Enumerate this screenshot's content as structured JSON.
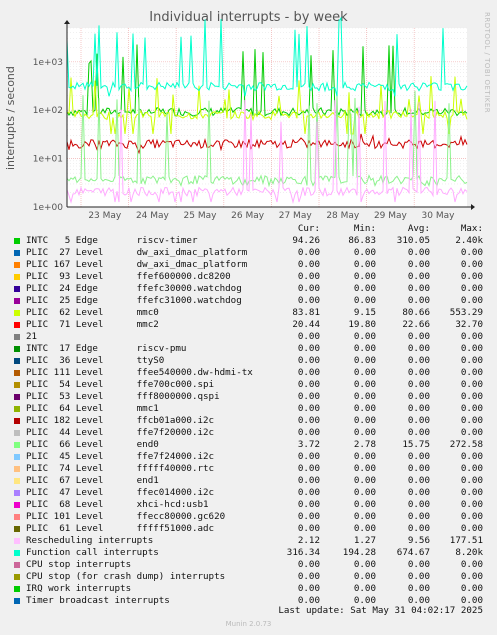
{
  "title": "Individual interrupts - by week",
  "side_text": "RRDTOOL / TOBI OETIKER",
  "ylabel": "interrupts / second",
  "headers": {
    "cur": "Cur:",
    "min": "Min:",
    "avg": "Avg:",
    "max": "Max:"
  },
  "footer": "Last update: Sat May 31 04:02:17 2025",
  "munin": "Munin 2.0.73",
  "chart_data": {
    "type": "line",
    "title": "Individual interrupts - by week",
    "ylabel": "interrupts / second",
    "yscale": "log",
    "ylim": [
      1,
      5000
    ],
    "yticks": [
      "1e+00",
      "1e+01",
      "1e+02",
      "1e+03"
    ],
    "xticks": [
      "23 May",
      "24 May",
      "25 May",
      "26 May",
      "27 May",
      "28 May",
      "29 May",
      "30 May"
    ],
    "grid": true,
    "series": [
      {
        "name": "INTC 5 Edge riscv-timer",
        "color": "#00cc00",
        "level": 94.26,
        "min": 86.83,
        "max": 2400
      },
      {
        "name": "PLIC 62 Level mmc0",
        "color": "#ccff00",
        "level": 80.66,
        "min": 9.15,
        "max": 553.29
      },
      {
        "name": "PLIC 71 Level mmc2",
        "color": "#cc0000",
        "level": 20.44,
        "min": 19.8,
        "max": 32.7
      },
      {
        "name": "PLIC 66 Level end0",
        "color": "#8cf28c",
        "level": 3.72,
        "min": 2.78,
        "max": 272.58
      },
      {
        "name": "Rescheduling interrupts",
        "color": "#ffaaff",
        "level": 2.12,
        "min": 1.27,
        "max": 177.51
      },
      {
        "name": "Function call interrupts",
        "color": "#00ffcc",
        "level": 316.34,
        "min": 194.28,
        "max": 8200
      }
    ]
  },
  "legend": [
    {
      "color": "#00cc00",
      "src": "INTC",
      "irq": "5",
      "type": "Edge",
      "name": "riscv-timer",
      "cur": "94.26",
      "min": "86.83",
      "avg": "310.05",
      "max": "2.40k"
    },
    {
      "color": "#0066b3",
      "src": "PLIC",
      "irq": "27",
      "type": "Level",
      "name": "dw_axi_dmac_platform",
      "cur": "0.00",
      "min": "0.00",
      "avg": "0.00",
      "max": "0.00"
    },
    {
      "color": "#ff8000",
      "src": "PLIC",
      "irq": "167",
      "type": "Level",
      "name": "dw_axi_dmac_platform",
      "cur": "0.00",
      "min": "0.00",
      "avg": "0.00",
      "max": "0.00"
    },
    {
      "color": "#ffcc00",
      "src": "PLIC",
      "irq": "93",
      "type": "Level",
      "name": "ffef600000.dc8200",
      "cur": "0.00",
      "min": "0.00",
      "avg": "0.00",
      "max": "0.00"
    },
    {
      "color": "#330099",
      "src": "PLIC",
      "irq": "24",
      "type": "Edge",
      "name": "ffefc30000.watchdog",
      "cur": "0.00",
      "min": "0.00",
      "avg": "0.00",
      "max": "0.00"
    },
    {
      "color": "#990099",
      "src": "PLIC",
      "irq": "25",
      "type": "Edge",
      "name": "ffefc31000.watchdog",
      "cur": "0.00",
      "min": "0.00",
      "avg": "0.00",
      "max": "0.00"
    },
    {
      "color": "#ccff00",
      "src": "PLIC",
      "irq": "62",
      "type": "Level",
      "name": "mmc0",
      "cur": "83.81",
      "min": "9.15",
      "avg": "80.66",
      "max": "553.29"
    },
    {
      "color": "#ff0000",
      "src": "PLIC",
      "irq": "71",
      "type": "Level",
      "name": "mmc2",
      "cur": "20.44",
      "min": "19.80",
      "avg": "22.66",
      "max": "32.70"
    },
    {
      "color": "#808080",
      "src": "21",
      "irq": "",
      "type": "",
      "name": "",
      "cur": "0.00",
      "min": "0.00",
      "avg": "0.00",
      "max": "0.00"
    },
    {
      "color": "#008f00",
      "src": "INTC",
      "irq": "17",
      "type": "Edge",
      "name": "riscv-pmu",
      "cur": "0.00",
      "min": "0.00",
      "avg": "0.00",
      "max": "0.00"
    },
    {
      "color": "#00487d",
      "src": "PLIC",
      "irq": "36",
      "type": "Level",
      "name": "ttyS0",
      "cur": "0.00",
      "min": "0.00",
      "avg": "0.00",
      "max": "0.00"
    },
    {
      "color": "#b35a00",
      "src": "PLIC",
      "irq": "111",
      "type": "Level",
      "name": "ffee540000.dw-hdmi-tx",
      "cur": "0.00",
      "min": "0.00",
      "avg": "0.00",
      "max": "0.00"
    },
    {
      "color": "#b38f00",
      "src": "PLIC",
      "irq": "54",
      "type": "Level",
      "name": "ffe700c000.spi",
      "cur": "0.00",
      "min": "0.00",
      "avg": "0.00",
      "max": "0.00"
    },
    {
      "color": "#6b006b",
      "src": "PLIC",
      "irq": "53",
      "type": "Level",
      "name": "fff8000000.qspi",
      "cur": "0.00",
      "min": "0.00",
      "avg": "0.00",
      "max": "0.00"
    },
    {
      "color": "#8fb300",
      "src": "PLIC",
      "irq": "64",
      "type": "Level",
      "name": "mmc1",
      "cur": "0.00",
      "min": "0.00",
      "avg": "0.00",
      "max": "0.00"
    },
    {
      "color": "#b30000",
      "src": "PLIC",
      "irq": "182",
      "type": "Level",
      "name": "ffcb01a000.i2c",
      "cur": "0.00",
      "min": "0.00",
      "avg": "0.00",
      "max": "0.00"
    },
    {
      "color": "#bebebe",
      "src": "PLIC",
      "irq": "44",
      "type": "Level",
      "name": "ffe7f20000.i2c",
      "cur": "0.00",
      "min": "0.00",
      "avg": "0.00",
      "max": "0.00"
    },
    {
      "color": "#80ff80",
      "src": "PLIC",
      "irq": "66",
      "type": "Level",
      "name": "end0",
      "cur": "3.72",
      "min": "2.78",
      "avg": "15.75",
      "max": "272.58"
    },
    {
      "color": "#80c9ff",
      "src": "PLIC",
      "irq": "45",
      "type": "Level",
      "name": "ffe7f24000.i2c",
      "cur": "0.00",
      "min": "0.00",
      "avg": "0.00",
      "max": "0.00"
    },
    {
      "color": "#ffc080",
      "src": "PLIC",
      "irq": "74",
      "type": "Level",
      "name": "fffff40000.rtc",
      "cur": "0.00",
      "min": "0.00",
      "avg": "0.00",
      "max": "0.00"
    },
    {
      "color": "#ffe680",
      "src": "PLIC",
      "irq": "67",
      "type": "Level",
      "name": "end1",
      "cur": "0.00",
      "min": "0.00",
      "avg": "0.00",
      "max": "0.00"
    },
    {
      "color": "#aa80ff",
      "src": "PLIC",
      "irq": "47",
      "type": "Level",
      "name": "ffec014000.i2c",
      "cur": "0.00",
      "min": "0.00",
      "avg": "0.00",
      "max": "0.00"
    },
    {
      "color": "#ee00cc",
      "src": "PLIC",
      "irq": "68",
      "type": "Level",
      "name": "xhci-hcd:usb1",
      "cur": "0.00",
      "min": "0.00",
      "avg": "0.00",
      "max": "0.00"
    },
    {
      "color": "#ff8080",
      "src": "PLIC",
      "irq": "101",
      "type": "Level",
      "name": "ffecc80000.gc620",
      "cur": "0.00",
      "min": "0.00",
      "avg": "0.00",
      "max": "0.00"
    },
    {
      "color": "#666600",
      "src": "PLIC",
      "irq": "61",
      "type": "Level",
      "name": "fffff51000.adc",
      "cur": "0.00",
      "min": "0.00",
      "avg": "0.00",
      "max": "0.00"
    },
    {
      "color": "#ffbfff",
      "src": "Rescheduling interrupts",
      "irq": "",
      "type": "",
      "name": "",
      "cur": "2.12",
      "min": "1.27",
      "avg": "9.56",
      "max": "177.51"
    },
    {
      "color": "#00ffcc",
      "src": "Function call interrupts",
      "irq": "",
      "type": "",
      "name": "",
      "cur": "316.34",
      "min": "194.28",
      "avg": "674.67",
      "max": "8.20k"
    },
    {
      "color": "#cc6699",
      "src": "CPU stop interrupts",
      "irq": "",
      "type": "",
      "name": "",
      "cur": "0.00",
      "min": "0.00",
      "avg": "0.00",
      "max": "0.00"
    },
    {
      "color": "#999900",
      "src": "CPU stop (for crash dump) interrupts",
      "irq": "",
      "type": "",
      "name": "",
      "cur": "0.00",
      "min": "0.00",
      "avg": "0.00",
      "max": "0.00"
    },
    {
      "color": "#00cc00",
      "src": "IRQ work interrupts",
      "irq": "",
      "type": "",
      "name": "",
      "cur": "0.00",
      "min": "0.00",
      "avg": "0.00",
      "max": "0.00"
    },
    {
      "color": "#0066b3",
      "src": "Timer broadcast interrupts",
      "irq": "",
      "type": "",
      "name": "",
      "cur": "0.00",
      "min": "0.00",
      "avg": "0.00",
      "max": "0.00"
    }
  ]
}
